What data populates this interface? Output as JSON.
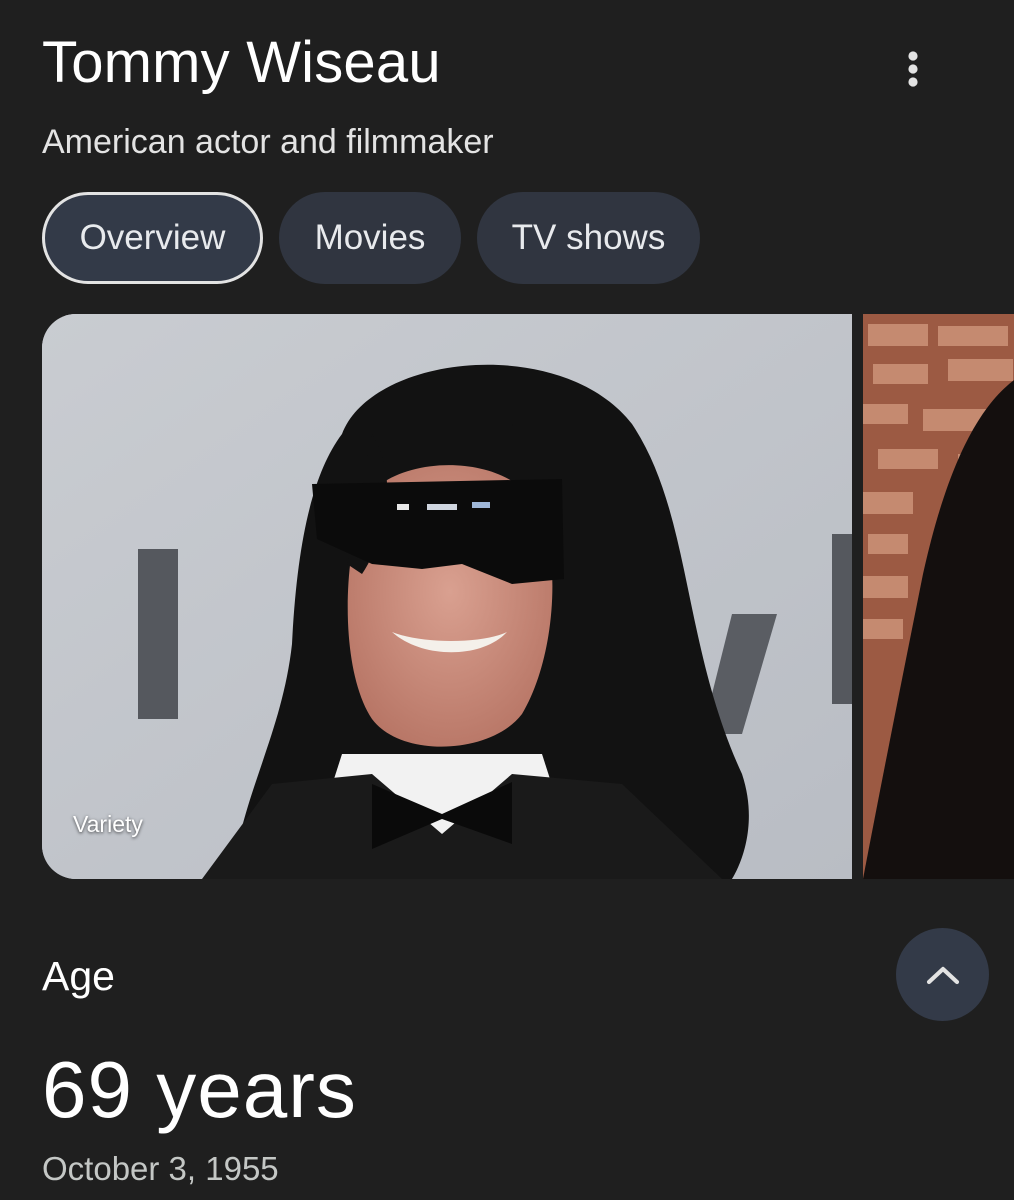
{
  "header": {
    "title": "Tommy Wiseau",
    "subtitle": "American actor and filmmaker",
    "more_icon": "more-vert-icon"
  },
  "tabs": [
    {
      "label": "Overview",
      "active": true
    },
    {
      "label": "Movies",
      "active": false
    },
    {
      "label": "TV shows",
      "active": false
    }
  ],
  "images": {
    "main_caption": "Variety"
  },
  "age": {
    "label": "Age",
    "value": "69 years",
    "birthdate": "October 3, 1955",
    "collapse_icon": "chevron-up-icon"
  },
  "colors": {
    "background": "#1f1f1f",
    "chip": "#303540",
    "chip_active_border": "#e3e3e3"
  }
}
